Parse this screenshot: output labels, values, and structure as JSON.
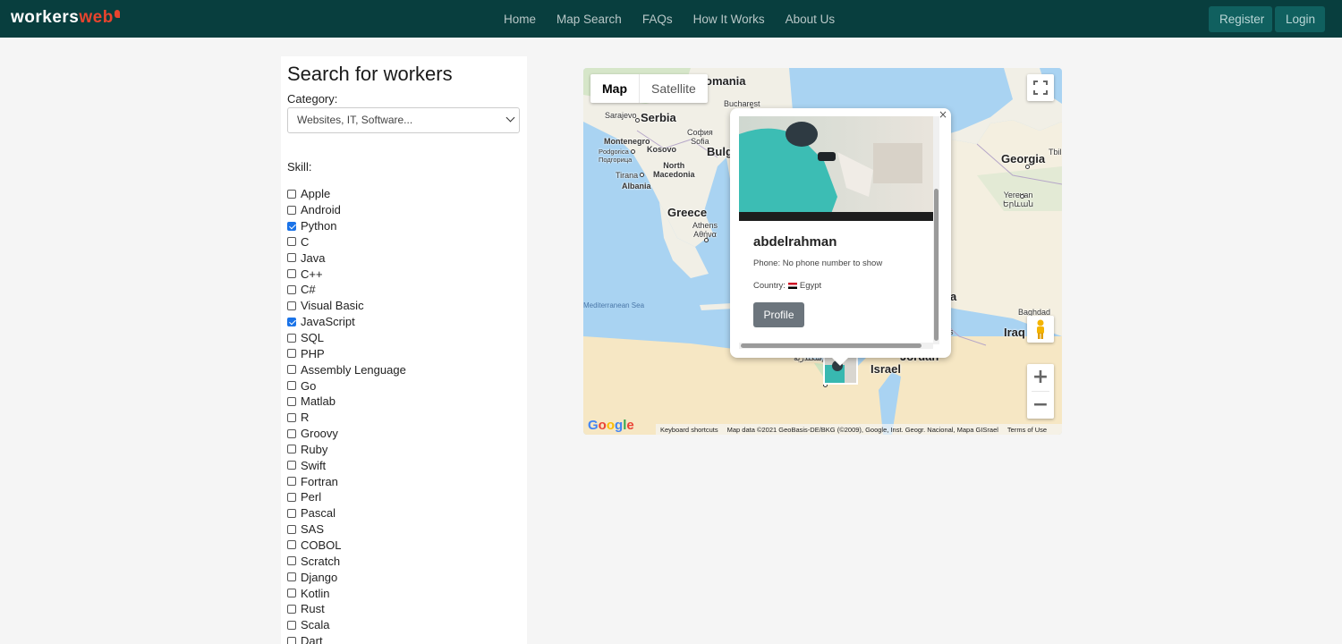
{
  "navbar": {
    "logo_part1": "workers",
    "logo_part2": "web",
    "links": [
      "Home",
      "Map Search",
      "FAQs",
      "How It Works",
      "About Us"
    ],
    "register_label": "Register",
    "login_label": "Login",
    "bg_color": "#083e3e"
  },
  "sidebar": {
    "title": "Search for workers",
    "category_label": "Category:",
    "category_selected": "Websites, IT, Software...",
    "skill_label": "Skill:",
    "skills": [
      {
        "label": "Apple",
        "checked": false
      },
      {
        "label": "Android",
        "checked": false
      },
      {
        "label": "Python",
        "checked": true
      },
      {
        "label": "C",
        "checked": false
      },
      {
        "label": "Java",
        "checked": false
      },
      {
        "label": "C++",
        "checked": false
      },
      {
        "label": "C#",
        "checked": false
      },
      {
        "label": "Visual Basic",
        "checked": false
      },
      {
        "label": "JavaScript",
        "checked": true
      },
      {
        "label": "SQL",
        "checked": false
      },
      {
        "label": "PHP",
        "checked": false
      },
      {
        "label": "Assembly Lenguage",
        "checked": false
      },
      {
        "label": "Go",
        "checked": false
      },
      {
        "label": "Matlab",
        "checked": false
      },
      {
        "label": "R",
        "checked": false
      },
      {
        "label": "Groovy",
        "checked": false
      },
      {
        "label": "Ruby",
        "checked": false
      },
      {
        "label": "Swift",
        "checked": false
      },
      {
        "label": "Fortran",
        "checked": false
      },
      {
        "label": "Perl",
        "checked": false
      },
      {
        "label": "Pascal",
        "checked": false
      },
      {
        "label": "SAS",
        "checked": false
      },
      {
        "label": "COBOL",
        "checked": false
      },
      {
        "label": "Scratch",
        "checked": false
      },
      {
        "label": "Django",
        "checked": false
      },
      {
        "label": "Kotlin",
        "checked": false
      },
      {
        "label": "Rust",
        "checked": false
      },
      {
        "label": "Scala",
        "checked": false
      },
      {
        "label": "Dart",
        "checked": false
      }
    ]
  },
  "map": {
    "type_map": "Map",
    "type_satellite": "Satellite",
    "labels": {
      "romania": "omania",
      "bucharest": "Bucharest",
      "sarajevo": "Sarajevo",
      "serbia": "Serbia",
      "sofia": "София\nSofia",
      "bulg": "Bulg",
      "montenegro": "Montenegro",
      "podgorica": "Podgorica\nПодгорица",
      "kosovo": "Kosovo",
      "north_macedonia": "North\nMacedonia",
      "tirana": "Tirana",
      "albania": "Albania",
      "greece": "Greece",
      "athens": "Athens\nΑθήνα",
      "georgia": "Georgia",
      "tbil": "Tbil",
      "yerevan": "Yerevan\nԵրևան",
      "mediterranean": "Mediterranean Sea",
      "baghdad": "Baghdad",
      "iraq": "Iraq",
      "jordan": "Jordan",
      "israel": "Israel",
      "a_fragment": "a",
      "s_fragment": "s",
      "alexandria": "الإسكندرية"
    },
    "google": "Google",
    "attribution": [
      "Keyboard shortcuts",
      "Map data ©2021 GeoBasis-DE/BKG (©2009), Google, Inst. Geogr. Nacional, Mapa GISrael",
      "Terms of Use"
    ],
    "infowindow": {
      "name": "abdelrahman",
      "phone_text": "Phone: No phone number to show",
      "country_label": "Country:",
      "country_value": "Egypt",
      "profile_button": "Profile",
      "close_symbol": "×"
    }
  }
}
